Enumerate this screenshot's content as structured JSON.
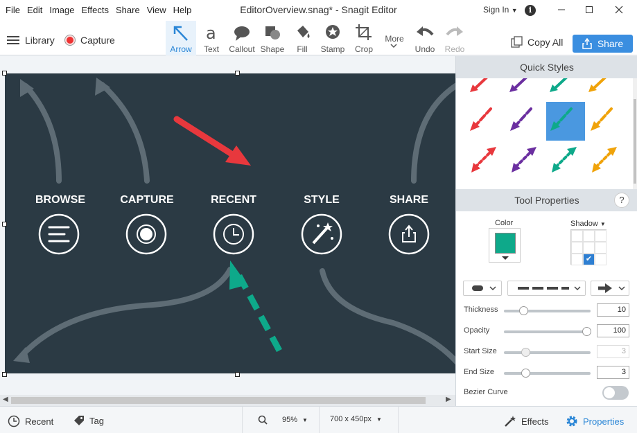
{
  "menu": [
    "File",
    "Edit",
    "Image",
    "Effects",
    "Share",
    "View",
    "Help"
  ],
  "window_title": "EditorOverview.snag* - Snagit Editor",
  "signin": "Sign In",
  "toolbar": {
    "library": "Library",
    "capture": "Capture",
    "tools": [
      {
        "label": "Arrow",
        "icon": "arrow-tool-icon"
      },
      {
        "label": "Text",
        "icon": "text-tool-icon"
      },
      {
        "label": "Callout",
        "icon": "callout-tool-icon"
      },
      {
        "label": "Shape",
        "icon": "shape-tool-icon"
      },
      {
        "label": "Fill",
        "icon": "fill-tool-icon"
      },
      {
        "label": "Stamp",
        "icon": "stamp-tool-icon"
      },
      {
        "label": "Crop",
        "icon": "crop-tool-icon"
      },
      {
        "label": "More",
        "icon": "chevron-down-icon"
      },
      {
        "label": "Undo",
        "icon": "undo-icon"
      },
      {
        "label": "Redo",
        "icon": "redo-icon"
      }
    ],
    "copy_all": "Copy All",
    "share": "Share"
  },
  "canvas": {
    "labels": [
      "BROWSE",
      "CAPTURE",
      "RECENT",
      "STYLE",
      "SHARE"
    ],
    "background": "#2b3a44",
    "red_arrow": "#e8383d",
    "green_arrow": "#0ea98a"
  },
  "panel": {
    "quick_styles_title": "Quick Styles",
    "tool_properties_title": "Tool Properties",
    "help": "?",
    "color_label": "Color",
    "color_value": "#0ea98a",
    "shadow_label": "Shadow",
    "properties": [
      {
        "label": "Thickness",
        "value": "10",
        "fill": 0.22
      },
      {
        "label": "Opacity",
        "value": "100",
        "fill": 1.0
      },
      {
        "label": "Start Size",
        "value": "3",
        "fill": 0.25
      },
      {
        "label": "End Size",
        "value": "3",
        "fill": 0.25
      }
    ],
    "bezier_label": "Bezier Curve",
    "bezier_on": false
  },
  "statusbar": {
    "recent": "Recent",
    "tag": "Tag",
    "zoom": "95%",
    "dimensions": "700 x 450px",
    "effects": "Effects",
    "properties": "Properties"
  }
}
